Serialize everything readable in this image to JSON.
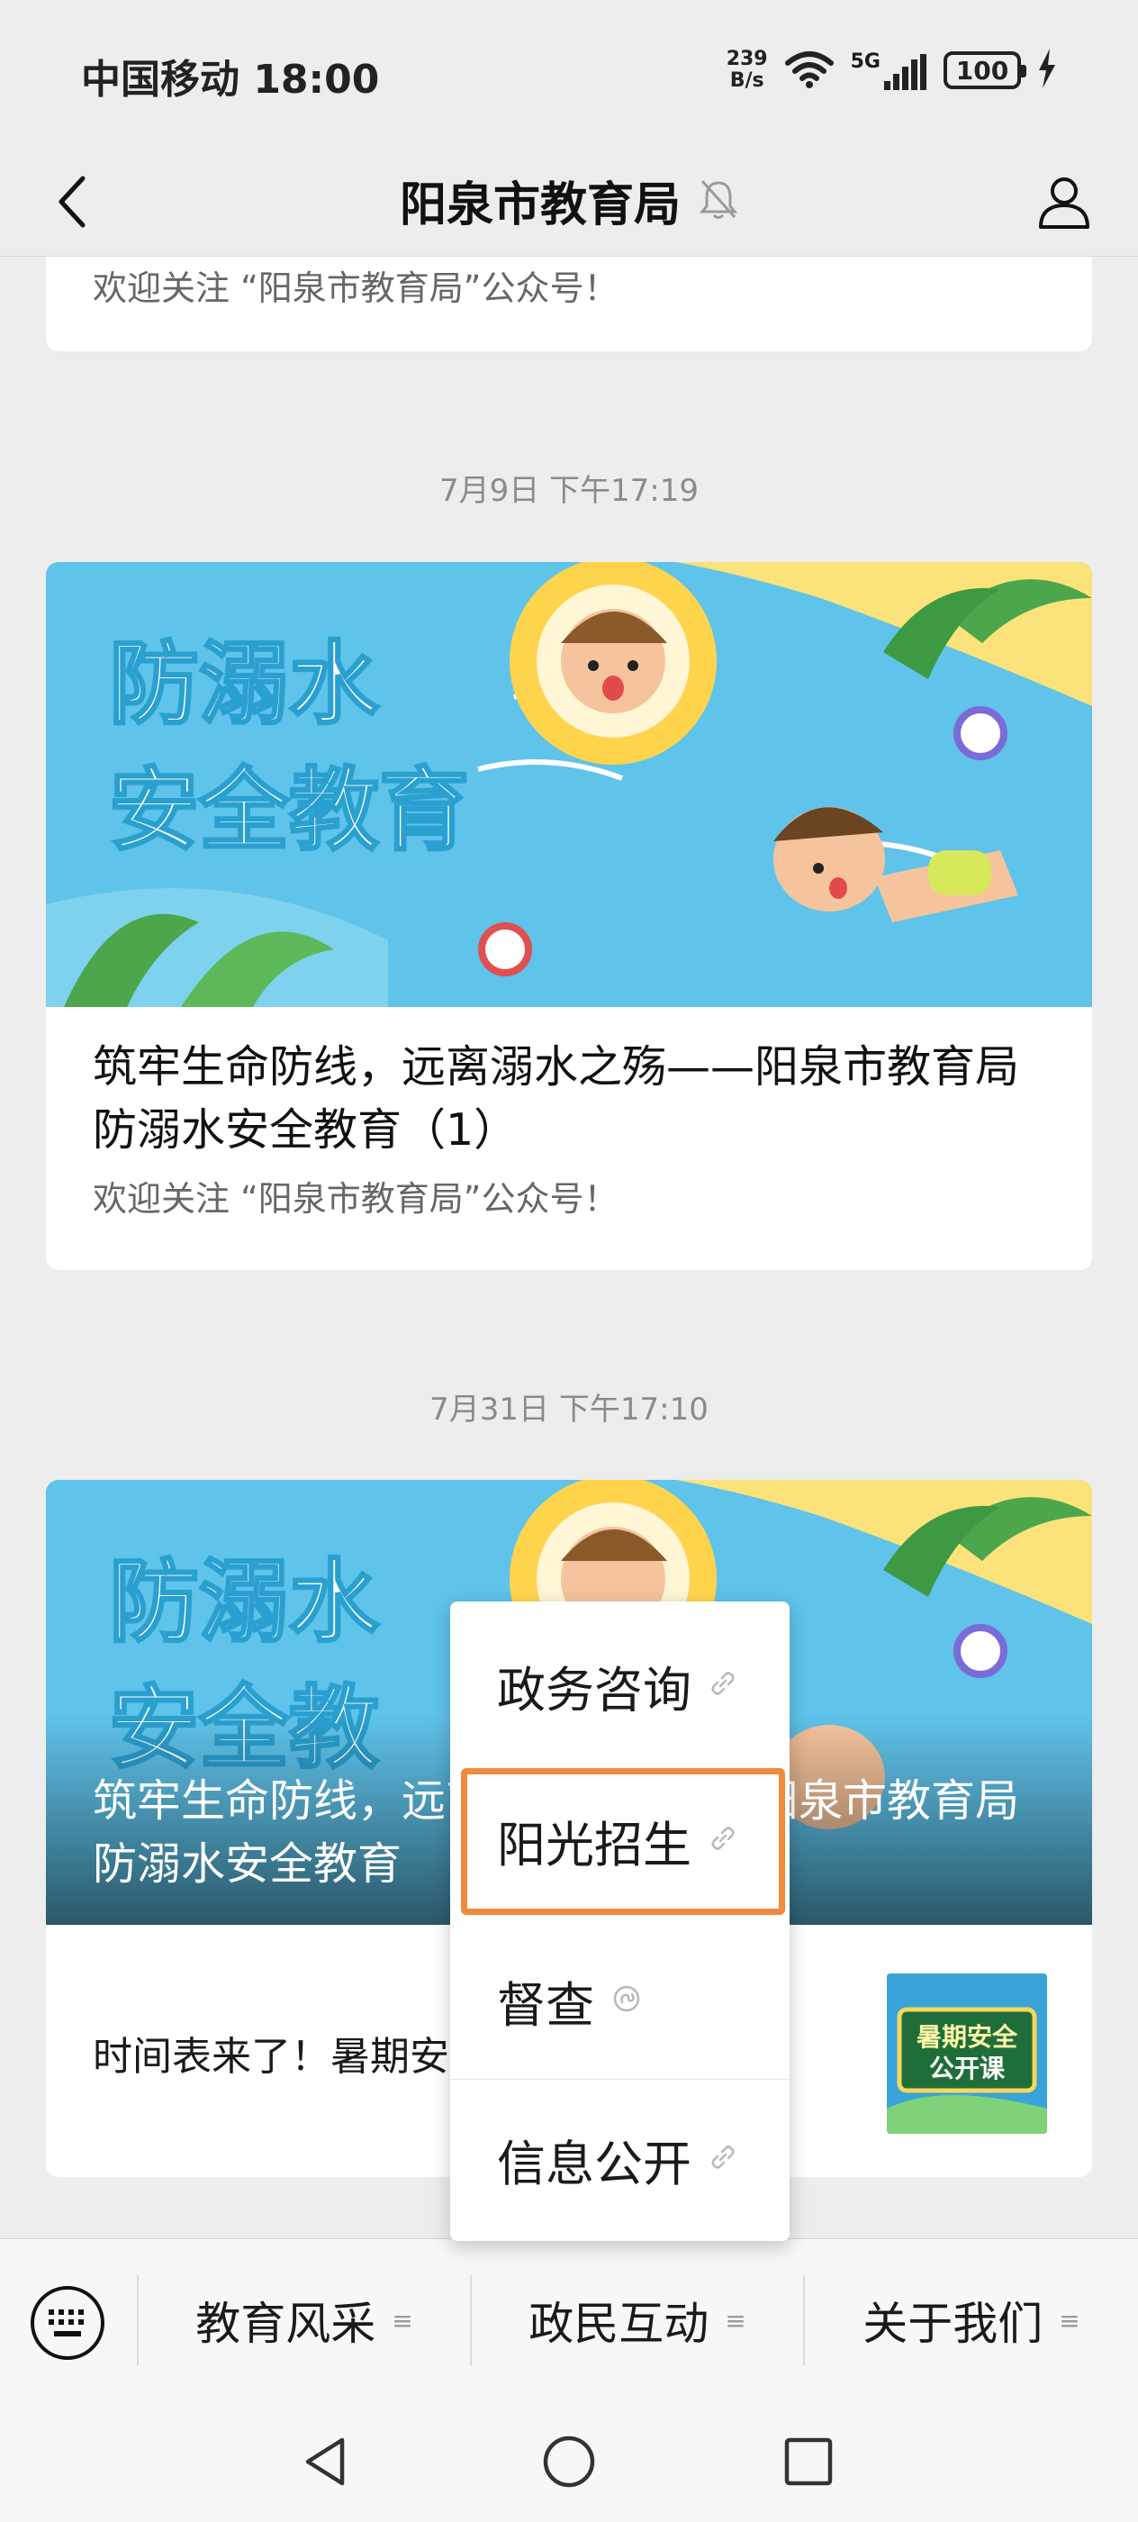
{
  "status_bar": {
    "carrier_time": "中国移动 18:00",
    "net_speed_value": "239",
    "net_speed_unit": "B/s",
    "network_type": "5G",
    "battery": "100"
  },
  "header": {
    "title": "阳泉市教育局"
  },
  "feed": {
    "partial_card": {
      "subtitle": "欢迎关注 “阳泉市教育局”公众号！"
    },
    "post1": {
      "timestamp": "7月9日 下午17:19",
      "cover_line1": "防溺水",
      "cover_line2": "安全教育",
      "title": "筑牢生命防线，远离溺水之殇——阳泉市教育局防溺水安全教育（1）",
      "subtitle": "欢迎关注 “阳泉市教育局”公众号！"
    },
    "post2": {
      "timestamp": "7月31日 下午17:10",
      "cover_line1": "防溺水",
      "cover_line2": "安全教",
      "overlay_title": "筑牢生命防线，远离溺水之殇——阳泉市教育局防溺水安全教育",
      "sub_item_text": "时间表来了！暑期安",
      "thumb_line1": "暑期安全",
      "thumb_line2": "公开课"
    }
  },
  "popup_menu": {
    "items": [
      {
        "label": "政务咨询"
      },
      {
        "label": "阳光招生"
      },
      {
        "label": "督查"
      },
      {
        "label": "信息公开"
      }
    ],
    "highlighted_index": 1
  },
  "menu_bar": {
    "tabs": [
      {
        "label": "教育风采"
      },
      {
        "label": "政民互动"
      },
      {
        "label": "关于我们"
      }
    ]
  },
  "colors": {
    "highlight": "#f08a3c",
    "background": "#ededed",
    "card": "#ffffff"
  },
  "icons": {
    "back": "chevron-left-icon",
    "mute": "bell-muted-icon",
    "profile": "person-icon",
    "link": "link-icon",
    "keyboard": "keyboard-icon",
    "menu": "hamburger-icon"
  }
}
